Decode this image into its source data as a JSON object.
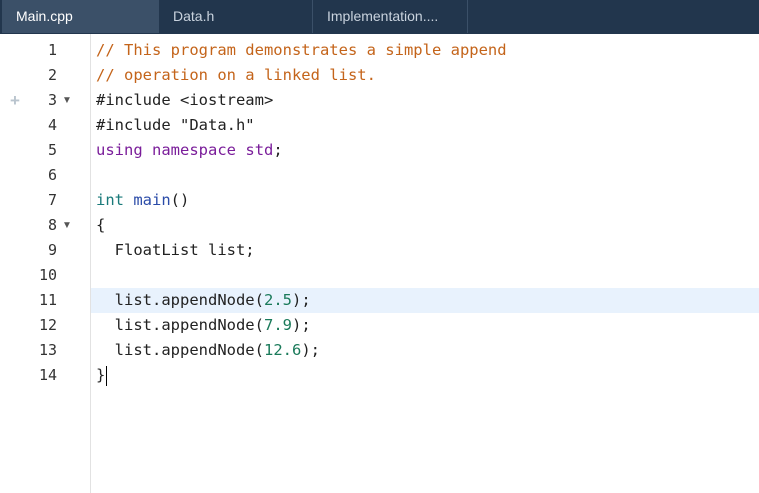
{
  "tabs": [
    {
      "label": "Main.cpp",
      "active": true
    },
    {
      "label": "Data.h",
      "active": false
    },
    {
      "label": "Implementation....",
      "active": false
    }
  ],
  "colors": {
    "tabbar_bg": "#22364d",
    "active_tab_bg": "#3b5068",
    "comment": "#c4641a",
    "keyword": "#7a1d9a",
    "type": "#1a7a7a",
    "function": "#2a4ba8",
    "number": "#1a7a5a",
    "plain": "#222222",
    "current_line_bg": "#e8f2fd"
  },
  "editor": {
    "current_line": 11,
    "lines": [
      {
        "num": "1",
        "fold": "",
        "gutter_icon": "",
        "tokens": [
          {
            "t": "// This program demonstrates a simple append",
            "c": "comment"
          }
        ]
      },
      {
        "num": "2",
        "fold": "",
        "gutter_icon": "",
        "tokens": [
          {
            "t": "// operation on a linked list.",
            "c": "comment"
          }
        ]
      },
      {
        "num": "3",
        "fold": "▼",
        "gutter_icon": "+",
        "tokens": [
          {
            "t": "#include <iostream>",
            "c": "plain"
          }
        ]
      },
      {
        "num": "4",
        "fold": "",
        "gutter_icon": "",
        "tokens": [
          {
            "t": "#include \"Data.h\"",
            "c": "plain"
          }
        ]
      },
      {
        "num": "5",
        "fold": "",
        "gutter_icon": "",
        "tokens": [
          {
            "t": "using",
            "c": "keyword"
          },
          {
            "t": " ",
            "c": "plain"
          },
          {
            "t": "namespace",
            "c": "keyword"
          },
          {
            "t": " ",
            "c": "plain"
          },
          {
            "t": "std",
            "c": "keyword"
          },
          {
            "t": ";",
            "c": "plain"
          }
        ]
      },
      {
        "num": "6",
        "fold": "",
        "gutter_icon": "",
        "tokens": []
      },
      {
        "num": "7",
        "fold": "",
        "gutter_icon": "",
        "tokens": [
          {
            "t": "int",
            "c": "type"
          },
          {
            "t": " ",
            "c": "plain"
          },
          {
            "t": "main",
            "c": "function"
          },
          {
            "t": "()",
            "c": "plain"
          }
        ]
      },
      {
        "num": "8",
        "fold": "▼",
        "gutter_icon": "",
        "tokens": [
          {
            "t": "{",
            "c": "plain"
          }
        ]
      },
      {
        "num": "9",
        "fold": "",
        "gutter_icon": "",
        "tokens": [
          {
            "t": "  FloatList list;",
            "c": "plain"
          }
        ]
      },
      {
        "num": "10",
        "fold": "",
        "gutter_icon": "",
        "tokens": []
      },
      {
        "num": "11",
        "fold": "",
        "gutter_icon": "",
        "tokens": [
          {
            "t": "  list.appendNode(",
            "c": "plain"
          },
          {
            "t": "2.5",
            "c": "number"
          },
          {
            "t": ");",
            "c": "plain"
          }
        ]
      },
      {
        "num": "12",
        "fold": "",
        "gutter_icon": "",
        "tokens": [
          {
            "t": "  list.appendNode(",
            "c": "plain"
          },
          {
            "t": "7.9",
            "c": "number"
          },
          {
            "t": ");",
            "c": "plain"
          }
        ]
      },
      {
        "num": "13",
        "fold": "",
        "gutter_icon": "",
        "tokens": [
          {
            "t": "  list.appendNode(",
            "c": "plain"
          },
          {
            "t": "12.6",
            "c": "number"
          },
          {
            "t": ");",
            "c": "plain"
          }
        ]
      },
      {
        "num": "14",
        "fold": "",
        "gutter_icon": "",
        "tokens": [
          {
            "t": "}",
            "c": "plain"
          }
        ],
        "caret": true
      }
    ]
  }
}
